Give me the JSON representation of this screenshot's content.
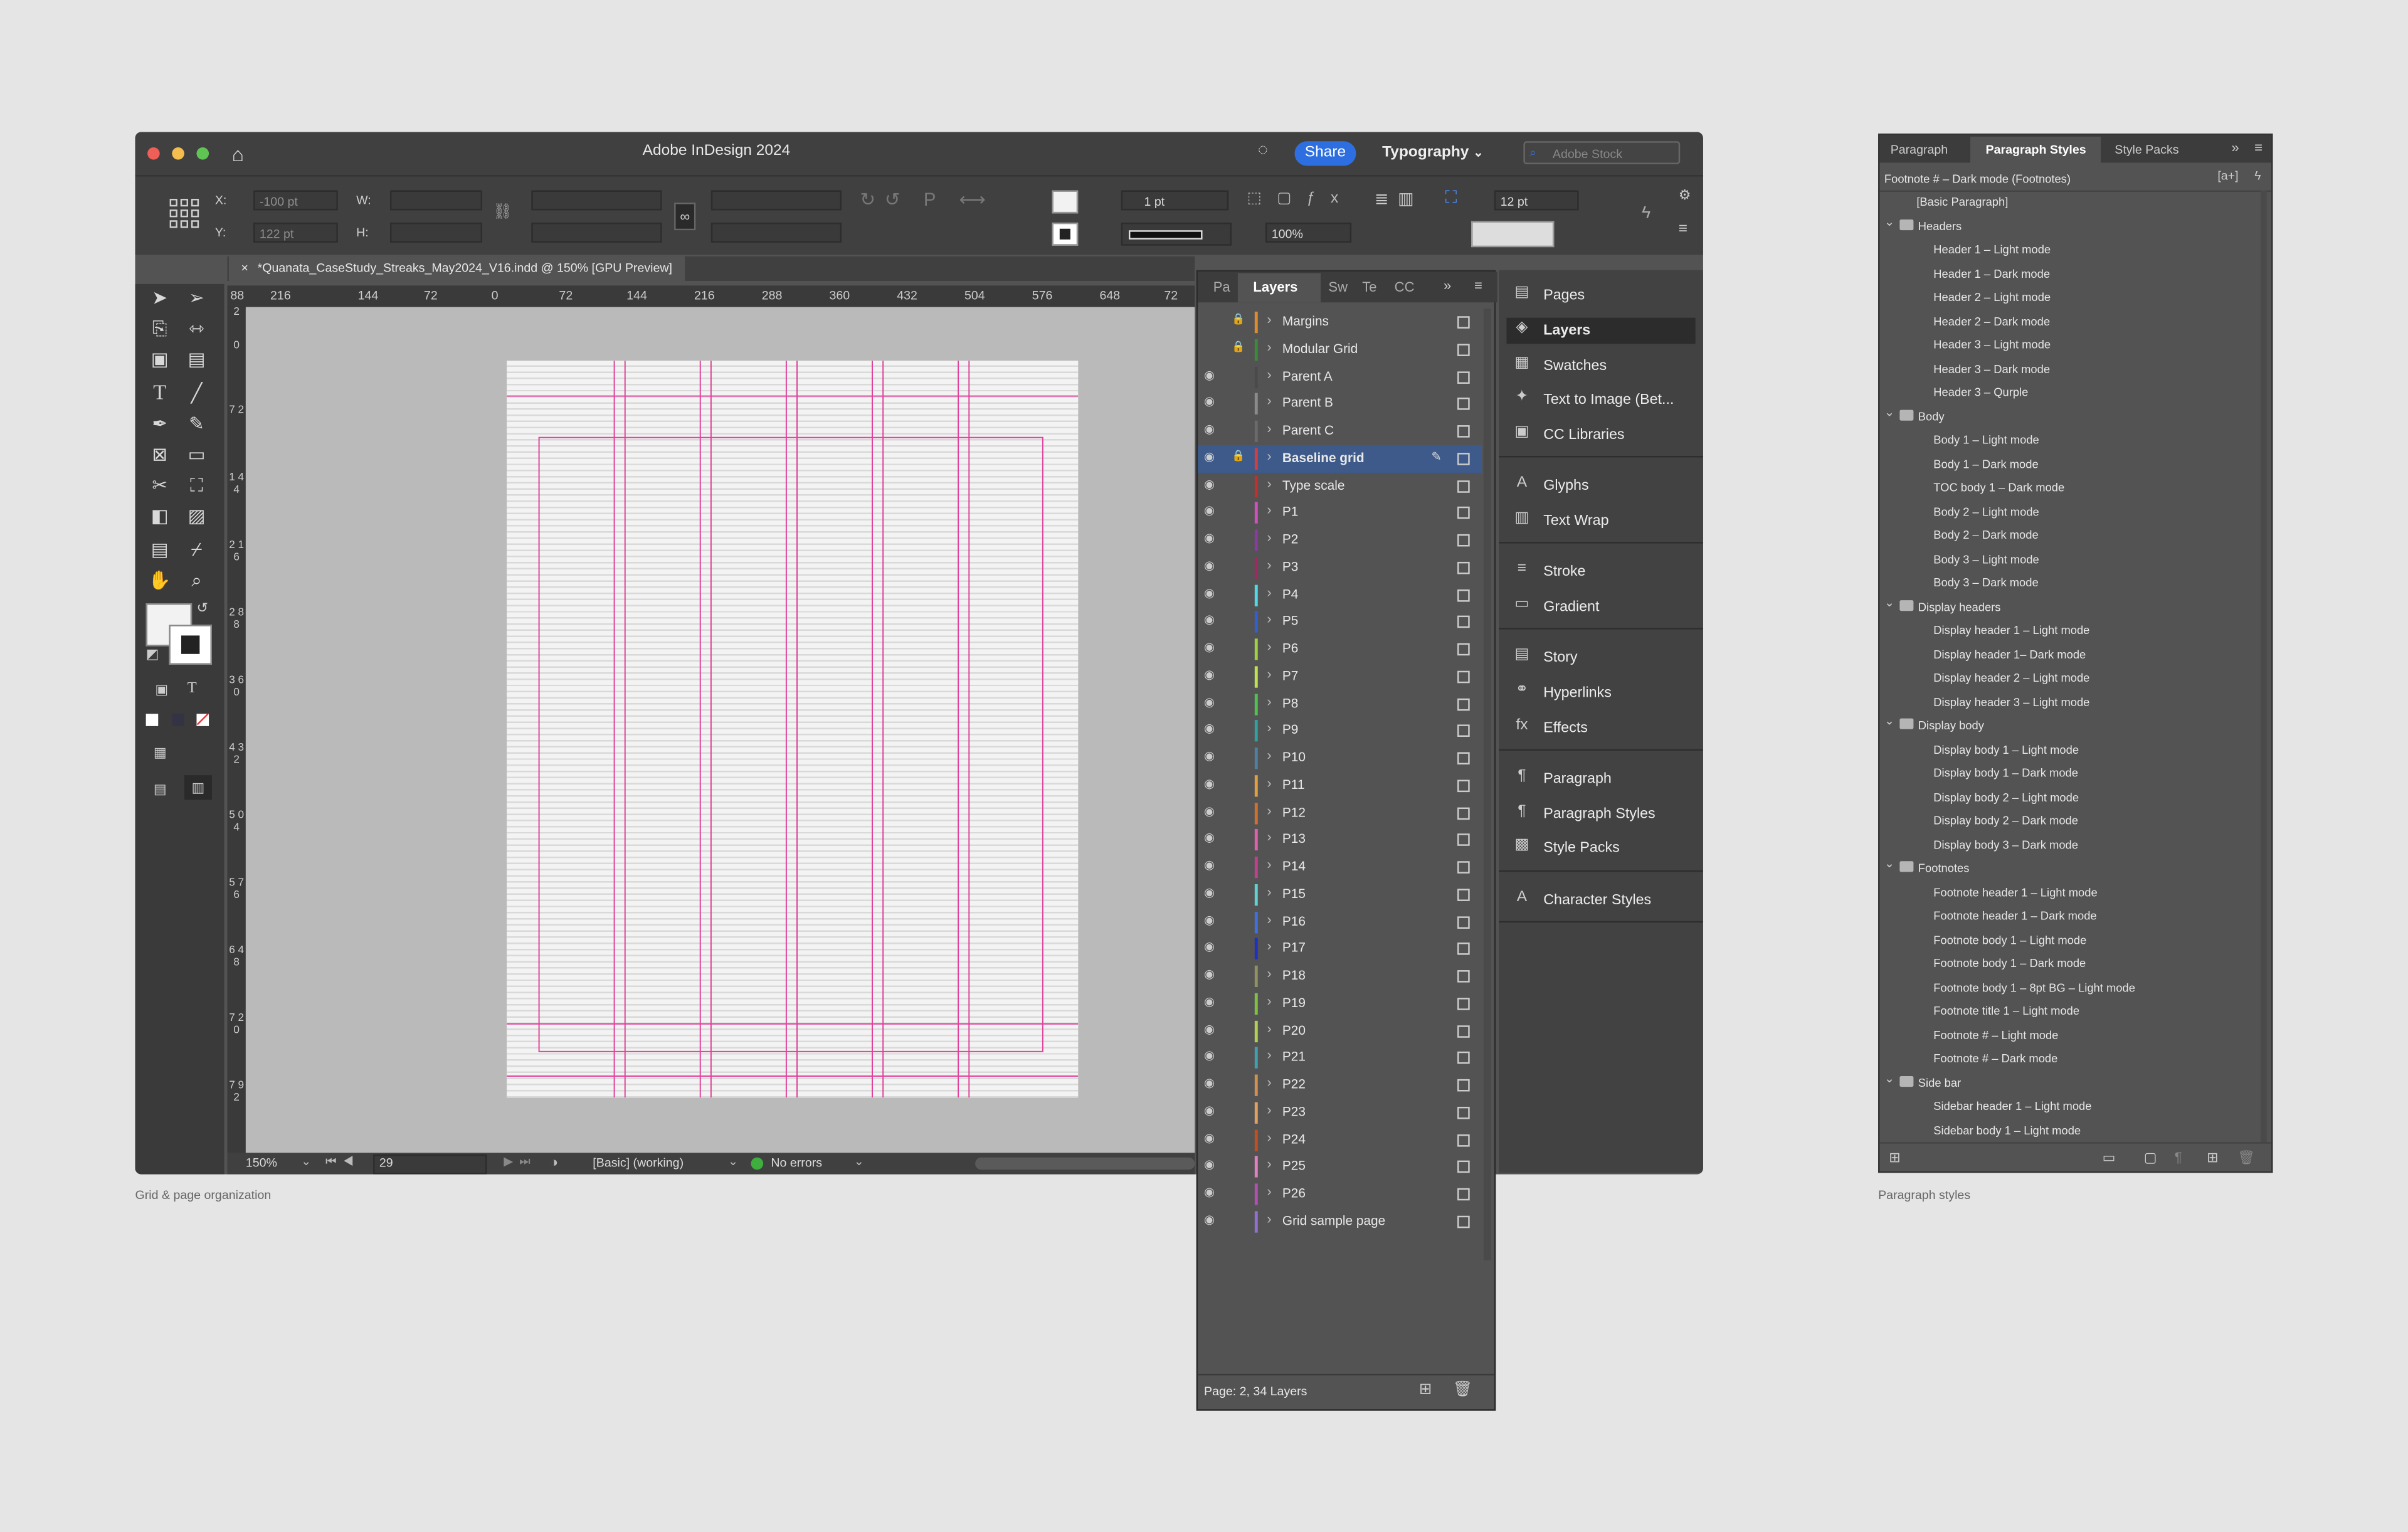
{
  "app": {
    "title": "Adobe InDesign 2024",
    "share_label": "Share",
    "workspace": "Typography",
    "search_placeholder": "Adobe Stock"
  },
  "control": {
    "x_label": "X:",
    "x_value": "-100 pt",
    "y_label": "Y:",
    "y_value": "122 pt",
    "w_label": "W:",
    "h_label": "H:",
    "stroke_weight": "1 pt",
    "opacity": "100%",
    "leading": "12 pt"
  },
  "document": {
    "tab_title": "*Quanata_CaseStudy_Streaks_May2024_V16.indd @ 150% [GPU Preview]",
    "close_glyph": "×",
    "ruler_labels": [
      "88",
      "216",
      "144",
      "72",
      "0",
      "72",
      "144",
      "216",
      "288",
      "360",
      "432",
      "504",
      "576",
      "648",
      "72"
    ],
    "vruler_labels": [
      "2",
      "0",
      "7 2",
      "1 4 4",
      "2 1 6",
      "2 8 8",
      "3 6 0",
      "4 3 2",
      "5 0 4",
      "5 7 6",
      "6 4 8",
      "7 2 0",
      "7 9 2"
    ]
  },
  "status": {
    "zoom": "150%",
    "page": "29",
    "profile": "[Basic] (working)",
    "preflight": "No errors"
  },
  "layers_panel": {
    "tabs": [
      "Pa",
      "Layers",
      "Sw",
      "Te",
      "CC"
    ],
    "footer": "Page: 2, 34 Layers",
    "layers": [
      {
        "name": "Margins",
        "color": "#e08a2e",
        "eye": false,
        "lock": true,
        "selected": false
      },
      {
        "name": "Modular Grid",
        "color": "#3a8a3a",
        "eye": false,
        "lock": true,
        "selected": false
      },
      {
        "name": "Parent A",
        "color": "#4a4a4a",
        "eye": true,
        "lock": false,
        "selected": false
      },
      {
        "name": "Parent B",
        "color": "#8a8a8a",
        "eye": true,
        "lock": false,
        "selected": false
      },
      {
        "name": "Parent C",
        "color": "#6a6a6a",
        "eye": true,
        "lock": false,
        "selected": false
      },
      {
        "name": "Baseline grid",
        "color": "#d04040",
        "eye": true,
        "lock": true,
        "selected": true
      },
      {
        "name": "Type scale",
        "color": "#c03030",
        "eye": true,
        "lock": false,
        "selected": false
      },
      {
        "name": "P1",
        "color": "#d050c0",
        "eye": true,
        "lock": false,
        "selected": false
      },
      {
        "name": "P2",
        "color": "#8a3aa0",
        "eye": true,
        "lock": false,
        "selected": false
      },
      {
        "name": "P3",
        "color": "#a02a60",
        "eye": true,
        "lock": false,
        "selected": false
      },
      {
        "name": "P4",
        "color": "#50d8e8",
        "eye": true,
        "lock": false,
        "selected": false
      },
      {
        "name": "P5",
        "color": "#3060d0",
        "eye": true,
        "lock": false,
        "selected": false
      },
      {
        "name": "P6",
        "color": "#a0d040",
        "eye": true,
        "lock": false,
        "selected": false
      },
      {
        "name": "P7",
        "color": "#c0e050",
        "eye": true,
        "lock": false,
        "selected": false
      },
      {
        "name": "P8",
        "color": "#50c050",
        "eye": true,
        "lock": false,
        "selected": false
      },
      {
        "name": "P9",
        "color": "#30a0a0",
        "eye": true,
        "lock": false,
        "selected": false
      },
      {
        "name": "P10",
        "color": "#5080a0",
        "eye": true,
        "lock": false,
        "selected": false
      },
      {
        "name": "P11",
        "color": "#e0a040",
        "eye": true,
        "lock": false,
        "selected": false
      },
      {
        "name": "P12",
        "color": "#d07030",
        "eye": true,
        "lock": false,
        "selected": false
      },
      {
        "name": "P13",
        "color": "#e060b0",
        "eye": true,
        "lock": false,
        "selected": false
      },
      {
        "name": "P14",
        "color": "#c04090",
        "eye": true,
        "lock": false,
        "selected": false
      },
      {
        "name": "P15",
        "color": "#60d0d0",
        "eye": true,
        "lock": false,
        "selected": false
      },
      {
        "name": "P16",
        "color": "#4070e0",
        "eye": true,
        "lock": false,
        "selected": false
      },
      {
        "name": "P17",
        "color": "#2030c0",
        "eye": true,
        "lock": false,
        "selected": false
      },
      {
        "name": "P18",
        "color": "#909060",
        "eye": true,
        "lock": false,
        "selected": false
      },
      {
        "name": "P19",
        "color": "#80c040",
        "eye": true,
        "lock": false,
        "selected": false
      },
      {
        "name": "P20",
        "color": "#b0d050",
        "eye": true,
        "lock": false,
        "selected": false
      },
      {
        "name": "P21",
        "color": "#40a0b0",
        "eye": true,
        "lock": false,
        "selected": false
      },
      {
        "name": "P22",
        "color": "#d09050",
        "eye": true,
        "lock": false,
        "selected": false
      },
      {
        "name": "P23",
        "color": "#e0a060",
        "eye": true,
        "lock": false,
        "selected": false
      },
      {
        "name": "P24",
        "color": "#c05020",
        "eye": true,
        "lock": false,
        "selected": false
      },
      {
        "name": "P25",
        "color": "#e080c0",
        "eye": true,
        "lock": false,
        "selected": false
      },
      {
        "name": "P26",
        "color": "#b050b0",
        "eye": true,
        "lock": false,
        "selected": false
      },
      {
        "name": "Grid sample page",
        "color": "#9070d0",
        "eye": true,
        "lock": false,
        "selected": false
      }
    ]
  },
  "side_panels": [
    {
      "label": "Pages",
      "icon": "pages-icon",
      "glyph": "▤"
    },
    {
      "label": "Layers",
      "icon": "layers-icon",
      "glyph": "◈",
      "active": true
    },
    {
      "label": "Swatches",
      "icon": "swatches-icon",
      "glyph": "▦"
    },
    {
      "label": "Text to Image (Bet...",
      "icon": "text-to-image-icon",
      "glyph": "✦"
    },
    {
      "label": "CC Libraries",
      "icon": "cc-libraries-icon",
      "glyph": "▣"
    },
    {
      "label": "Glyphs",
      "icon": "glyphs-icon",
      "glyph": "A"
    },
    {
      "label": "Text Wrap",
      "icon": "text-wrap-icon",
      "glyph": "▥"
    },
    {
      "label": "Stroke",
      "icon": "stroke-icon",
      "glyph": "≡"
    },
    {
      "label": "Gradient",
      "icon": "gradient-icon",
      "glyph": "▭"
    },
    {
      "label": "Story",
      "icon": "story-icon",
      "glyph": "▤"
    },
    {
      "label": "Hyperlinks",
      "icon": "hyperlinks-icon",
      "glyph": "⚭"
    },
    {
      "label": "Effects",
      "icon": "effects-icon",
      "glyph": "fx"
    },
    {
      "label": "Paragraph",
      "icon": "paragraph-icon",
      "glyph": "¶"
    },
    {
      "label": "Paragraph Styles",
      "icon": "paragraph-styles-icon",
      "glyph": "¶"
    },
    {
      "label": "Style Packs",
      "icon": "style-packs-icon",
      "glyph": "▩"
    },
    {
      "label": "Character Styles",
      "icon": "character-styles-icon",
      "glyph": "A"
    }
  ],
  "para_styles": {
    "tabs": [
      "Paragraph",
      "Paragraph Styles",
      "Style Packs"
    ],
    "current": "Footnote # – Dark mode (Footnotes)",
    "items": [
      {
        "t": "[Basic Paragraph]",
        "lvl": 1,
        "group": false
      },
      {
        "t": "Headers",
        "lvl": 0,
        "group": true
      },
      {
        "t": "Header 1 – Light mode",
        "lvl": 2,
        "group": false
      },
      {
        "t": "Header 1 – Dark mode",
        "lvl": 2,
        "group": false
      },
      {
        "t": "Header 2 – Light mode",
        "lvl": 2,
        "group": false
      },
      {
        "t": "Header 2 – Dark mode",
        "lvl": 2,
        "group": false
      },
      {
        "t": "Header 3 – Light mode",
        "lvl": 2,
        "group": false
      },
      {
        "t": "Header 3 – Dark mode",
        "lvl": 2,
        "group": false
      },
      {
        "t": "Header 3 – Qurple",
        "lvl": 2,
        "group": false
      },
      {
        "t": "Body",
        "lvl": 0,
        "group": true
      },
      {
        "t": "Body 1 – Light mode",
        "lvl": 2,
        "group": false
      },
      {
        "t": "Body 1 – Dark mode",
        "lvl": 2,
        "group": false
      },
      {
        "t": "TOC body 1 – Dark mode",
        "lvl": 2,
        "group": false
      },
      {
        "t": "Body 2 – Light mode",
        "lvl": 2,
        "group": false
      },
      {
        "t": "Body 2 – Dark mode",
        "lvl": 2,
        "group": false
      },
      {
        "t": "Body 3 – Light mode",
        "lvl": 2,
        "group": false
      },
      {
        "t": "Body 3 – Dark mode",
        "lvl": 2,
        "group": false
      },
      {
        "t": "Display headers",
        "lvl": 0,
        "group": true
      },
      {
        "t": "Display header 1 – Light mode",
        "lvl": 2,
        "group": false
      },
      {
        "t": "Display header 1– Dark mode",
        "lvl": 2,
        "group": false
      },
      {
        "t": "Display header 2 – Light mode",
        "lvl": 2,
        "group": false
      },
      {
        "t": "Display header 3 – Light mode",
        "lvl": 2,
        "group": false
      },
      {
        "t": "Display body",
        "lvl": 0,
        "group": true
      },
      {
        "t": "Display body 1 – Light mode",
        "lvl": 2,
        "group": false
      },
      {
        "t": "Display body 1 – Dark mode",
        "lvl": 2,
        "group": false
      },
      {
        "t": "Display body 2 – Light mode",
        "lvl": 2,
        "group": false
      },
      {
        "t": "Display body 2 – Dark mode",
        "lvl": 2,
        "group": false
      },
      {
        "t": "Display body 3 – Dark mode",
        "lvl": 2,
        "group": false
      },
      {
        "t": "Footnotes",
        "lvl": 0,
        "group": true
      },
      {
        "t": "Footnote header 1 – Light mode",
        "lvl": 2,
        "group": false
      },
      {
        "t": "Footnote header 1 – Dark mode",
        "lvl": 2,
        "group": false
      },
      {
        "t": "Footnote body 1 – Light mode",
        "lvl": 2,
        "group": false
      },
      {
        "t": "Footnote body 1 – Dark mode",
        "lvl": 2,
        "group": false
      },
      {
        "t": "Footnote body 1 – 8pt BG –  Light mode",
        "lvl": 2,
        "group": false
      },
      {
        "t": "Footnote title 1 – Light mode",
        "lvl": 2,
        "group": false
      },
      {
        "t": "Footnote # – Light mode",
        "lvl": 2,
        "group": false
      },
      {
        "t": "Footnote # – Dark mode",
        "lvl": 2,
        "group": false
      },
      {
        "t": "Side bar",
        "lvl": 0,
        "group": true
      },
      {
        "t": "Sidebar header 1 – Light mode",
        "lvl": 2,
        "group": false
      },
      {
        "t": "Sidebar body 1 – Light mode",
        "lvl": 2,
        "group": false
      }
    ]
  },
  "captions": {
    "left": "Grid & page organization",
    "right": "Paragraph styles"
  },
  "colors": {
    "guide": "#e0409a",
    "selection": "#3d5a8a",
    "accent": "#2d6fe0"
  }
}
